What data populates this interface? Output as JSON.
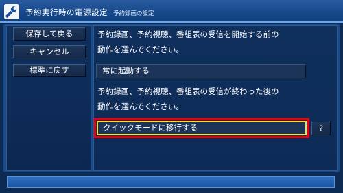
{
  "header": {
    "title": "予約実行時の電源設定",
    "subtitle": "予約録画の設定",
    "icon": "wrench-icon"
  },
  "menu": {
    "items": [
      "保存して戻る",
      "キャンセル",
      "標準に戻す"
    ]
  },
  "section1": {
    "description_line1": "予約録画、予約視聴、番組表の受信を開始する前の",
    "description_line2": "動作を選んでください。",
    "selected_value": "常に起動する"
  },
  "section2": {
    "description_line1": "予約録画、予約視聴、番組表の受信が終わった後の",
    "description_line2": "動作を選んでください。",
    "selected_value": "クイックモードに移行する"
  },
  "help": {
    "label": "?"
  },
  "colors": {
    "background": "#0d2a52",
    "header": "#174a8c",
    "focus_outer": "#e60012",
    "focus_inner": "#f2e23a"
  }
}
